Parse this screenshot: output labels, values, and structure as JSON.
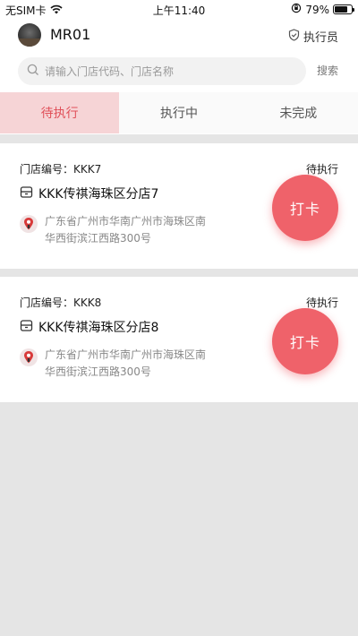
{
  "status_bar": {
    "carrier": "无SIM卡",
    "time": "上午11:40",
    "battery": "79%",
    "battery_level": 0.79
  },
  "header": {
    "username": "MR01",
    "role": "执行员"
  },
  "search": {
    "placeholder": "请输入门店代码、门店名称",
    "button_label": "搜索"
  },
  "tabs": [
    {
      "label": "待执行",
      "active": true
    },
    {
      "label": "执行中",
      "active": false
    },
    {
      "label": "未完成",
      "active": false
    }
  ],
  "stores": [
    {
      "code_label": "门店编号：KKK7",
      "status": "待执行",
      "name": "KKK传祺海珠区分店7",
      "address": "广东省广州市华南广州市海珠区南华西街滨江西路300号",
      "action": "打卡"
    },
    {
      "code_label": "门店编号：KKK8",
      "status": "待执行",
      "name": "KKK传祺海珠区分店8",
      "address": "广东省广州市华南广州市海珠区南华西街滨江西路300号",
      "action": "打卡"
    }
  ],
  "colors": {
    "accent": "#ef626a",
    "active_tab_bg": "#f6d4d6",
    "active_tab_text": "#e0515a",
    "page_bg": "#e5e5e5"
  },
  "icons": {
    "role": "shield-check-icon",
    "search": "search-icon",
    "store": "store-icon",
    "location": "location-pin-icon"
  }
}
